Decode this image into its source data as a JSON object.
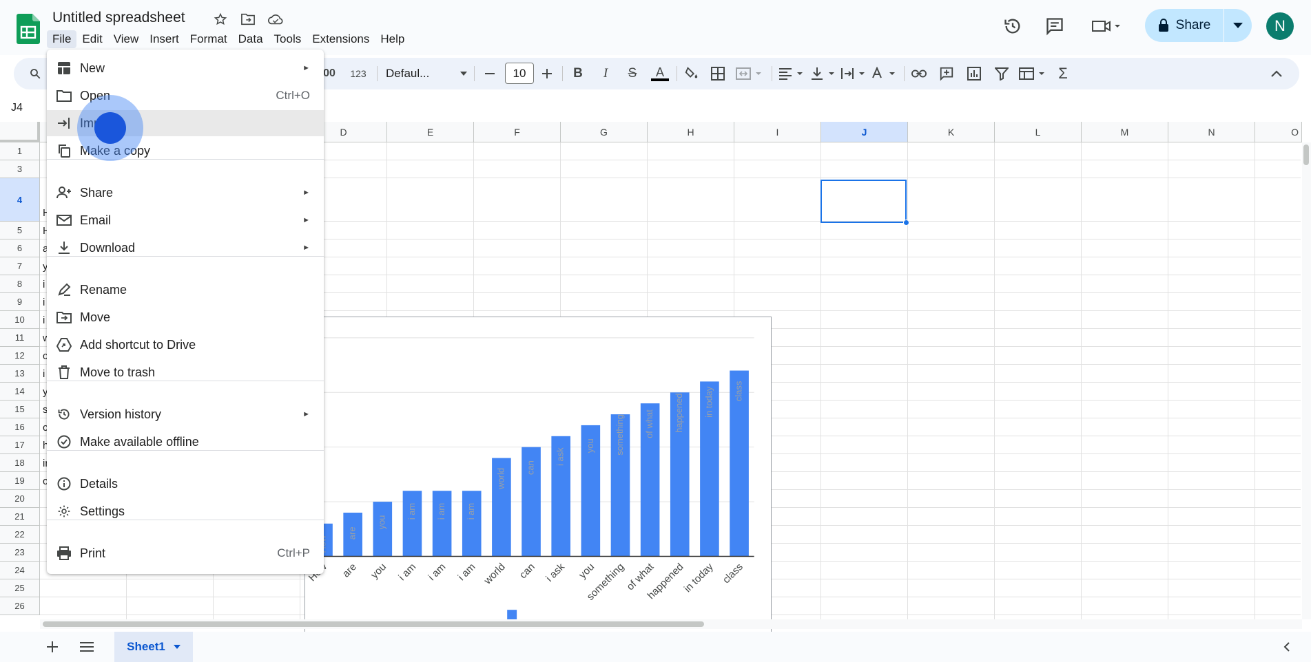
{
  "header": {
    "title": "Untitled spreadsheet",
    "menus": [
      "File",
      "Edit",
      "View",
      "Insert",
      "Format",
      "Data",
      "Tools",
      "Extensions",
      "Help"
    ],
    "share_label": "Share",
    "avatar_initial": "N"
  },
  "toolbar": {
    "format_123": "123",
    "font_name": "Defaul...",
    "font_size": "10",
    "zoom_fragment": "00"
  },
  "formula_bar": {
    "name_box": "J4"
  },
  "grid": {
    "columns": [
      "D",
      "E",
      "F",
      "G",
      "H",
      "I",
      "J",
      "K",
      "L",
      "M",
      "N",
      "O"
    ],
    "rows": [
      "1",
      "3",
      "4",
      "5",
      "6",
      "7",
      "8",
      "9",
      "10",
      "11",
      "12",
      "13",
      "14",
      "15",
      "16",
      "17",
      "18",
      "19",
      "20",
      "21",
      "22",
      "23",
      "24",
      "25",
      "26"
    ],
    "selected_cell": "J4",
    "col_a_fragments": [
      "H",
      "H",
      "a",
      "y",
      "i",
      "i",
      "i",
      "w",
      "c",
      "i",
      "y",
      "s",
      "c",
      "h",
      "ir",
      "c"
    ]
  },
  "chart_data": {
    "type": "bar",
    "categories": [
      "How",
      "are",
      "you",
      "i am",
      "i am",
      "i am",
      "world",
      "can",
      "i ask",
      "you",
      "something",
      "of what",
      "happened",
      "in today",
      "class"
    ],
    "values": [
      3,
      4,
      5,
      6,
      6,
      6,
      9,
      10,
      11,
      12,
      13,
      14,
      15,
      16,
      17
    ],
    "bar_labels": [
      "How",
      "are",
      "you",
      "i am",
      "i am",
      "i am",
      "world",
      "can",
      "i ask",
      "you",
      "something",
      "of what",
      "happened",
      "in today",
      "class"
    ],
    "ylim": [
      0,
      20
    ],
    "grid": true,
    "legend": "bottom",
    "color": "#4285f4"
  },
  "file_menu": {
    "items": [
      {
        "label": "New",
        "icon": "new-sheet-icon",
        "submenu": true
      },
      {
        "label": "Open",
        "icon": "folder-icon",
        "shortcut": "Ctrl+O"
      },
      {
        "label": "Import",
        "icon": "import-icon",
        "highlighted": true
      },
      {
        "label": "Make a copy",
        "icon": "copy-icon"
      },
      {
        "label": "Share",
        "icon": "person-add-icon",
        "submenu": true
      },
      {
        "label": "Email",
        "icon": "mail-icon",
        "submenu": true
      },
      {
        "label": "Download",
        "icon": "download-icon",
        "submenu": true
      },
      {
        "label": "Rename",
        "icon": "rename-icon"
      },
      {
        "label": "Move",
        "icon": "move-folder-icon"
      },
      {
        "label": "Add shortcut to Drive",
        "icon": "drive-shortcut-icon"
      },
      {
        "label": "Move to trash",
        "icon": "trash-icon"
      },
      {
        "label": "Version history",
        "icon": "history-icon",
        "submenu": true
      },
      {
        "label": "Make available offline",
        "icon": "offline-icon"
      },
      {
        "label": "Details",
        "icon": "info-icon"
      },
      {
        "label": "Settings",
        "icon": "gear-icon"
      },
      {
        "label": "Print",
        "icon": "print-icon",
        "shortcut": "Ctrl+P"
      }
    ],
    "submenu_arrow": "►"
  },
  "sheets": {
    "active": "Sheet1"
  },
  "colors": {
    "accent": "#0b57d0",
    "share_bg": "#c2e7ff",
    "bar": "#4285f4",
    "selection": "#1a73e8"
  }
}
